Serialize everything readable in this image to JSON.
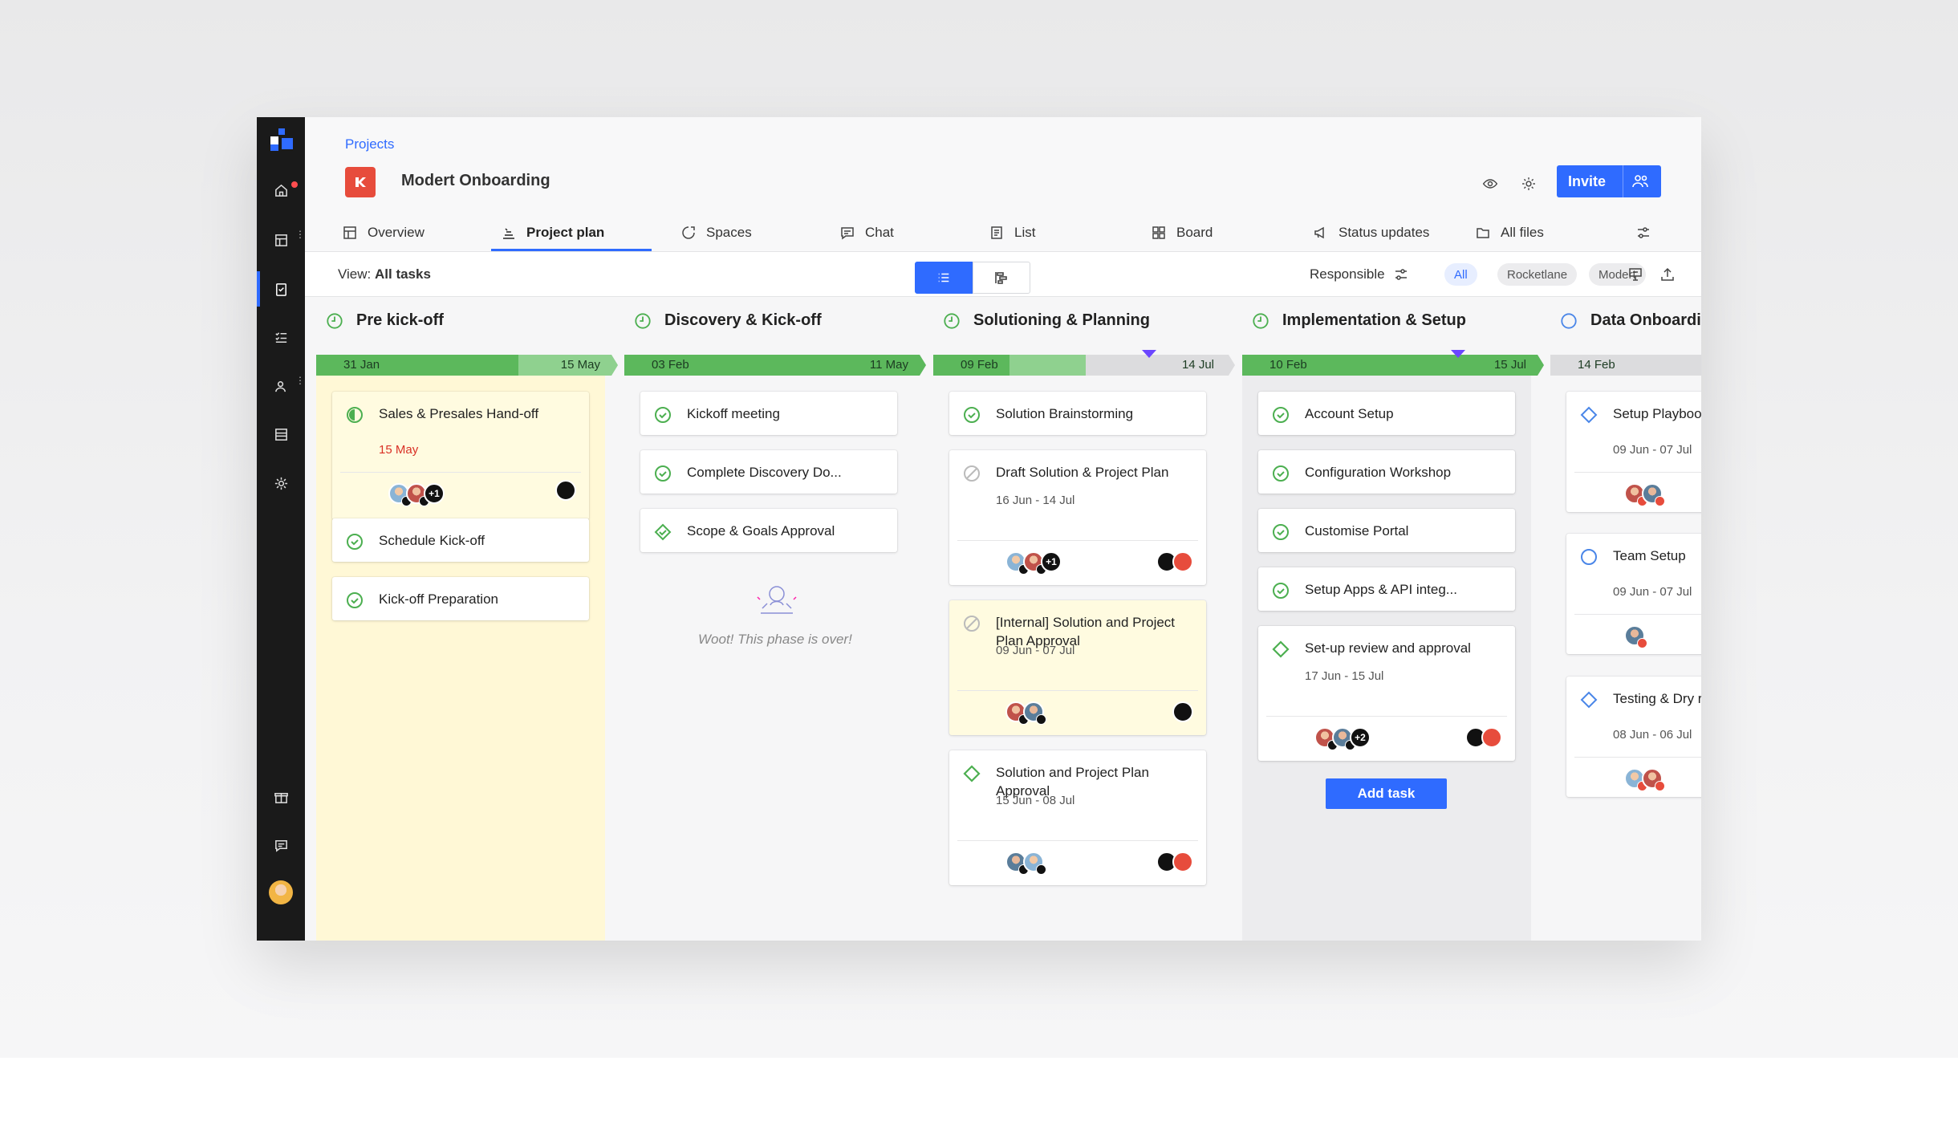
{
  "header": {
    "breadcrumb": "Projects",
    "project_title": "Modert Onboarding",
    "invite_label": "Invite"
  },
  "tabs": [
    {
      "label": "Overview",
      "icon": "overview-icon"
    },
    {
      "label": "Project plan",
      "icon": "project-plan-icon",
      "active": true
    },
    {
      "label": "Spaces",
      "icon": "spaces-icon"
    },
    {
      "label": "Chat",
      "icon": "chat-icon"
    },
    {
      "label": "List",
      "icon": "list-icon"
    },
    {
      "label": "Board",
      "icon": "board-icon"
    },
    {
      "label": "Status updates",
      "icon": "megaphone-icon"
    },
    {
      "label": "All files",
      "icon": "folder-icon"
    }
  ],
  "toolbar": {
    "view_prefix": "View:",
    "view_value": "All tasks",
    "responsible_label": "Responsible",
    "filters": [
      "All",
      "Rocketlane",
      "Modert"
    ],
    "selected_filter": "All"
  },
  "colors": {
    "accent": "#2f6bff",
    "done_green": "#4caf50",
    "timeline_green": "#5cb85c",
    "timeline_light": "#8fd18f",
    "pending_yellow": "#fffbe0",
    "today_marker": "#6b46ff"
  },
  "phases": [
    {
      "name": "Pre kick-off",
      "start": "31 Jan",
      "end": "15 May",
      "status": "complete",
      "tasks": [
        {
          "title": "Sales & Presales Hand-off",
          "date": "15 May",
          "overdue": true,
          "status": "in-progress",
          "assignees_more": "+1"
        },
        {
          "title": "Schedule Kick-off",
          "status": "done"
        },
        {
          "title": "Kick-off Preparation",
          "status": "done"
        }
      ]
    },
    {
      "name": "Discovery & Kick-off",
      "start": "03 Feb",
      "end": "11 May",
      "status": "complete",
      "tasks": [
        {
          "title": "Kickoff meeting",
          "status": "done"
        },
        {
          "title": "Complete Discovery Do...",
          "status": "done"
        },
        {
          "title": "Scope & Goals Approval",
          "status": "milestone-done"
        }
      ],
      "empty_message": "Woot! This phase is over!"
    },
    {
      "name": "Solutioning & Planning",
      "start": "09 Feb",
      "end": "14 Jul",
      "status": "complete",
      "tasks": [
        {
          "title": "Solution Brainstorming",
          "status": "done"
        },
        {
          "title": "Draft Solution & Project Plan",
          "date": "16 Jun - 14 Jul",
          "status": "blocked",
          "assignees_more": "+1"
        },
        {
          "title": "[Internal] Solution and Project Plan Approval",
          "date": "09 Jun - 07 Jul",
          "status": "blocked"
        },
        {
          "title": "Solution and Project Plan Approval",
          "date": "15 Jun - 08 Jul",
          "status": "milestone"
        }
      ]
    },
    {
      "name": "Implementation & Setup",
      "start": "10 Feb",
      "end": "15 Jul",
      "status": "complete",
      "tasks": [
        {
          "title": "Account Setup",
          "status": "done"
        },
        {
          "title": "Configuration Workshop",
          "status": "done"
        },
        {
          "title": "Customise Portal",
          "status": "done"
        },
        {
          "title": "Setup Apps & API integ...",
          "status": "done"
        },
        {
          "title": "Set-up review and approval",
          "date": "17 Jun - 15 Jul",
          "status": "milestone",
          "assignees_more": "+2"
        }
      ],
      "add_task_label": "Add task"
    },
    {
      "name": "Data Onboardi",
      "start": "14 Feb",
      "end": "",
      "status": "not-started",
      "tasks": [
        {
          "title": "Setup Playboo",
          "date": "09 Jun - 07 Jul",
          "status": "milestone-pending"
        },
        {
          "title": "Team Setup",
          "date": "09 Jun - 07 Jul",
          "status": "not-started"
        },
        {
          "title": "Testing & Dry r",
          "date": "08 Jun - 06 Jul",
          "status": "milestone-pending"
        }
      ]
    }
  ]
}
